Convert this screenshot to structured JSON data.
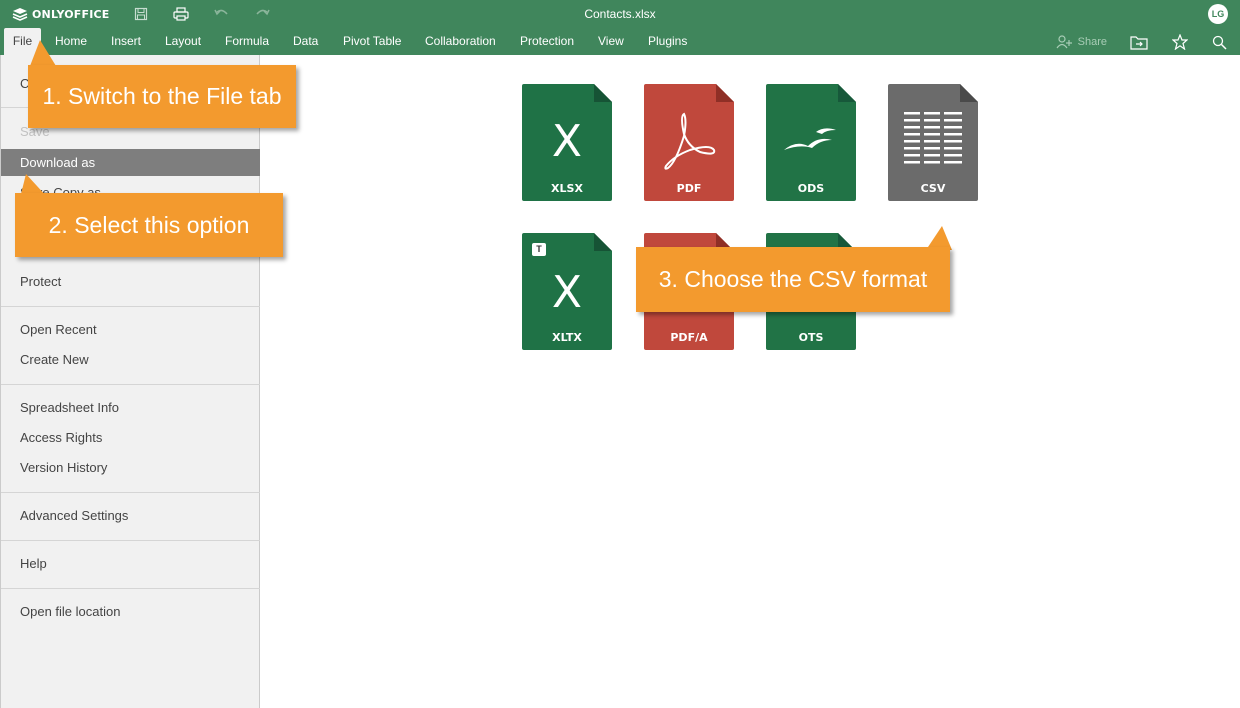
{
  "app": {
    "logo_text": "ONLYOFFICE",
    "document_title": "Contacts.xlsx",
    "user_initials": "LG"
  },
  "toolbar": {
    "save_icon": "save-icon",
    "print_icon": "print-icon",
    "undo_icon": "undo-icon",
    "redo_icon": "redo-icon"
  },
  "tabs": {
    "file": "File",
    "home": "Home",
    "insert": "Insert",
    "layout": "Layout",
    "formula": "Formula",
    "data": "Data",
    "pivot_table": "Pivot Table",
    "collaboration": "Collaboration",
    "protection": "Protection",
    "view": "View",
    "plugins": "Plugins"
  },
  "header_actions": {
    "share_label": "Share"
  },
  "file_menu": {
    "close_menu": "C",
    "save": "Save",
    "download_as": "Download as",
    "save_copy_as": "Save Copy as...",
    "protect": "Protect",
    "open_recent": "Open Recent",
    "create_new": "Create New",
    "spreadsheet_info": "Spreadsheet Info",
    "access_rights": "Access Rights",
    "version_history": "Version History",
    "advanced_settings": "Advanced Settings",
    "help": "Help",
    "open_file_location": "Open file location"
  },
  "formats": {
    "xlsx": {
      "label": "XLSX",
      "glyph": "X",
      "color": "#1f7246"
    },
    "pdf": {
      "label": "PDF",
      "color": "#c0483c"
    },
    "ods": {
      "label": "ODS",
      "color": "#217346"
    },
    "csv": {
      "label": "CSV",
      "color": "#6b6b6b"
    },
    "xltx": {
      "label": "XLTX",
      "glyph": "X",
      "badge": "T",
      "color": "#1f7246"
    },
    "pdfa": {
      "label": "PDF/A",
      "color": "#c0483c"
    },
    "ots": {
      "label": "OTS",
      "color": "#217346"
    }
  },
  "callouts": {
    "step1": "1. Switch to the File tab",
    "step2": "2. Select this option",
    "step3": "3. Choose the CSV format"
  },
  "colors": {
    "header_green": "#40865c",
    "callout_orange": "#f39a2e",
    "selected_gray": "#7e7e7e"
  }
}
